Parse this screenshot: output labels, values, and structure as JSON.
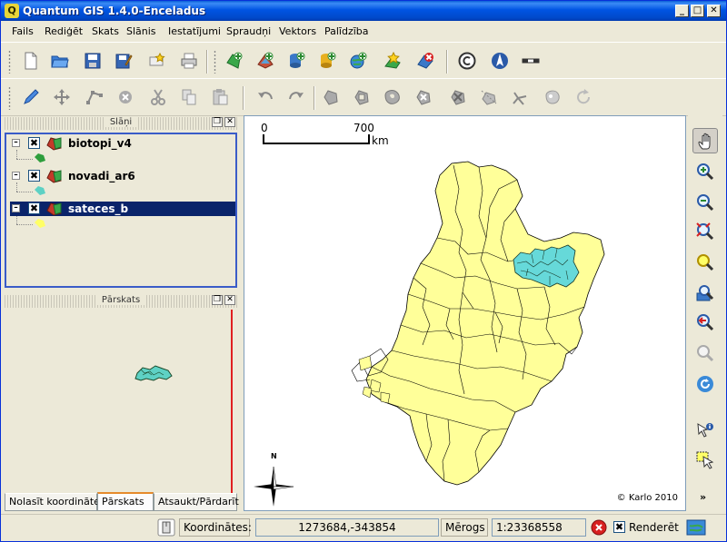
{
  "window": {
    "title": "Quantum GIS 1.4.0-Enceladus",
    "app_icon_glyph": "Q",
    "minimize": "_",
    "maximize": "□",
    "close": "✕"
  },
  "menu": [
    "Fails",
    "Rediģēt",
    "Skats",
    "Slānis",
    "Iestatījumi",
    "Spraudņi",
    "Vektors",
    "Palīdzība"
  ],
  "toolbar1": {
    "icons": [
      "new-project-icon",
      "open-project-icon",
      "save-project-icon",
      "save-as-icon",
      "new-print-composer-icon",
      "print-icon",
      "add-vector-layer-icon",
      "add-raster-layer-icon",
      "add-postgis-layer-icon",
      "add-spatialite-layer-icon",
      "add-wms-layer-icon",
      "new-vector-layer-icon",
      "remove-layer-icon",
      "copyright-label-icon",
      "north-arrow-icon",
      "scale-bar-icon"
    ]
  },
  "toolbar2": {
    "icons": [
      "toggle-editing-icon",
      "move-feature-icon",
      "node-tool-icon",
      "delete-selected-icon",
      "cut-features-icon",
      "copy-features-icon",
      "paste-features-icon",
      "undo-icon",
      "redo-icon",
      "simplify-feature-icon",
      "add-ring-icon",
      "add-island-icon",
      "delete-ring-icon",
      "delete-part-icon",
      "reshape-features-icon",
      "split-features-icon",
      "merge-features-icon",
      "rotate-point-symbols-icon"
    ]
  },
  "legend_panel": {
    "title": "Slāņi",
    "layers": [
      {
        "name": "biotopi_v4",
        "checked": "✖",
        "color": "#2e9e3c",
        "selected": false
      },
      {
        "name": "novadi_ar6",
        "checked": "✖",
        "color": "#5ed1c4",
        "selected": false
      },
      {
        "name": "sateces_b",
        "checked": "✖",
        "color": "#ffff66",
        "selected": true
      }
    ]
  },
  "overview_panel": {
    "title": "Pārskats"
  },
  "tabs": [
    "Nolasīt koordinātes",
    "Pārskats",
    "Atsaukt/Pārdarīt"
  ],
  "active_tab": "Pārskats",
  "map": {
    "scale_start": "0",
    "scale_end": "700",
    "scale_unit": "km",
    "north_label": "N",
    "copyright": "© Karlo 2010",
    "fill_color": "#ffff99",
    "highlight_color": "#66d9d9"
  },
  "map_tools": [
    "pan-icon",
    "zoom-in-icon",
    "zoom-out-icon",
    "zoom-full-icon",
    "zoom-to-selection-icon",
    "zoom-to-layer-icon",
    "zoom-last-icon",
    "zoom-next-icon",
    "refresh-icon",
    "identify-icon",
    "select-icon",
    "more-chevron-icon"
  ],
  "statusbar": {
    "coords_label": "Koordinātes:",
    "coords_value": "1273684,-343854",
    "scale_label": "Mērogs",
    "scale_value": "1:23368558",
    "render_label": "Renderēt",
    "render_checked": "✖"
  }
}
